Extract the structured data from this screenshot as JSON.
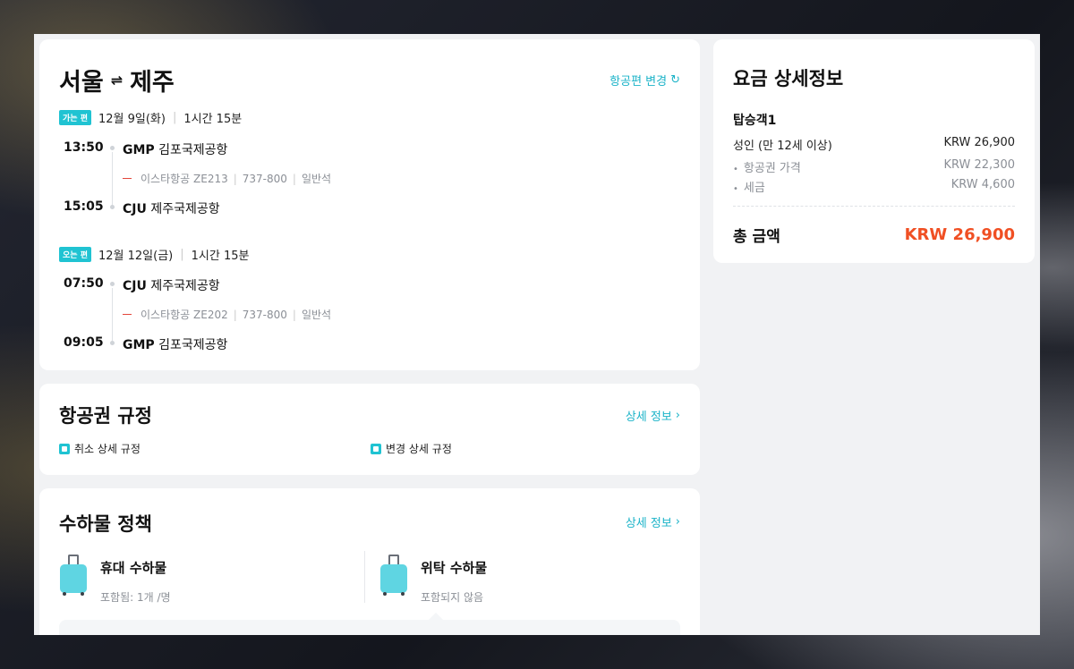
{
  "itinerary": {
    "from": "서울",
    "swap_symbol": "⇌",
    "to": "제주",
    "change_flight_link": "항공편 변경",
    "outbound": {
      "tag": "가는 편",
      "date": "12월 9일(화)",
      "duration": "1시간 15분",
      "dep_time": "13:50",
      "dep_code": "GMP",
      "dep_airport": "김포국제공항",
      "airline": "이스타항공 ZE213",
      "aircraft": "737-800",
      "cabin": "일반석",
      "arr_time": "15:05",
      "arr_code": "CJU",
      "arr_airport": "제주국제공항"
    },
    "inbound": {
      "tag": "오는 편",
      "date": "12월 12일(금)",
      "duration": "1시간 15분",
      "dep_time": "07:50",
      "dep_code": "CJU",
      "dep_airport": "제주국제공항",
      "airline": "이스타항공 ZE202",
      "aircraft": "737-800",
      "cabin": "일반석",
      "arr_time": "09:05",
      "arr_code": "GMP",
      "arr_airport": "김포국제공항"
    }
  },
  "rules": {
    "title": "항공권 규정",
    "detail_link": "상세 정보",
    "cancel_rules": "취소 상세 규정",
    "change_rules": "변경 상세 규정"
  },
  "baggage": {
    "title": "수하물 정책",
    "detail_link": "상세 정보",
    "carry_on_title": "휴대 수하물",
    "carry_on_sub": "포함됨: 1개 /명",
    "checked_title": "위탁 수하물",
    "checked_sub": "포함되지 않음"
  },
  "fare": {
    "title": "요금 상세정보",
    "passenger": "탑승객1",
    "adult_label": "성인 (만 12세 이상)",
    "adult_value": "KRW 26,900",
    "ticket_label": "항공권 가격",
    "ticket_value": "KRW 22,300",
    "tax_label": "세금",
    "tax_value": "KRW 4,600",
    "total_label": "총 금액",
    "total_value": "KRW 26,900"
  },
  "colors": {
    "accent": "#20c3d2",
    "total": "#f04f23"
  }
}
